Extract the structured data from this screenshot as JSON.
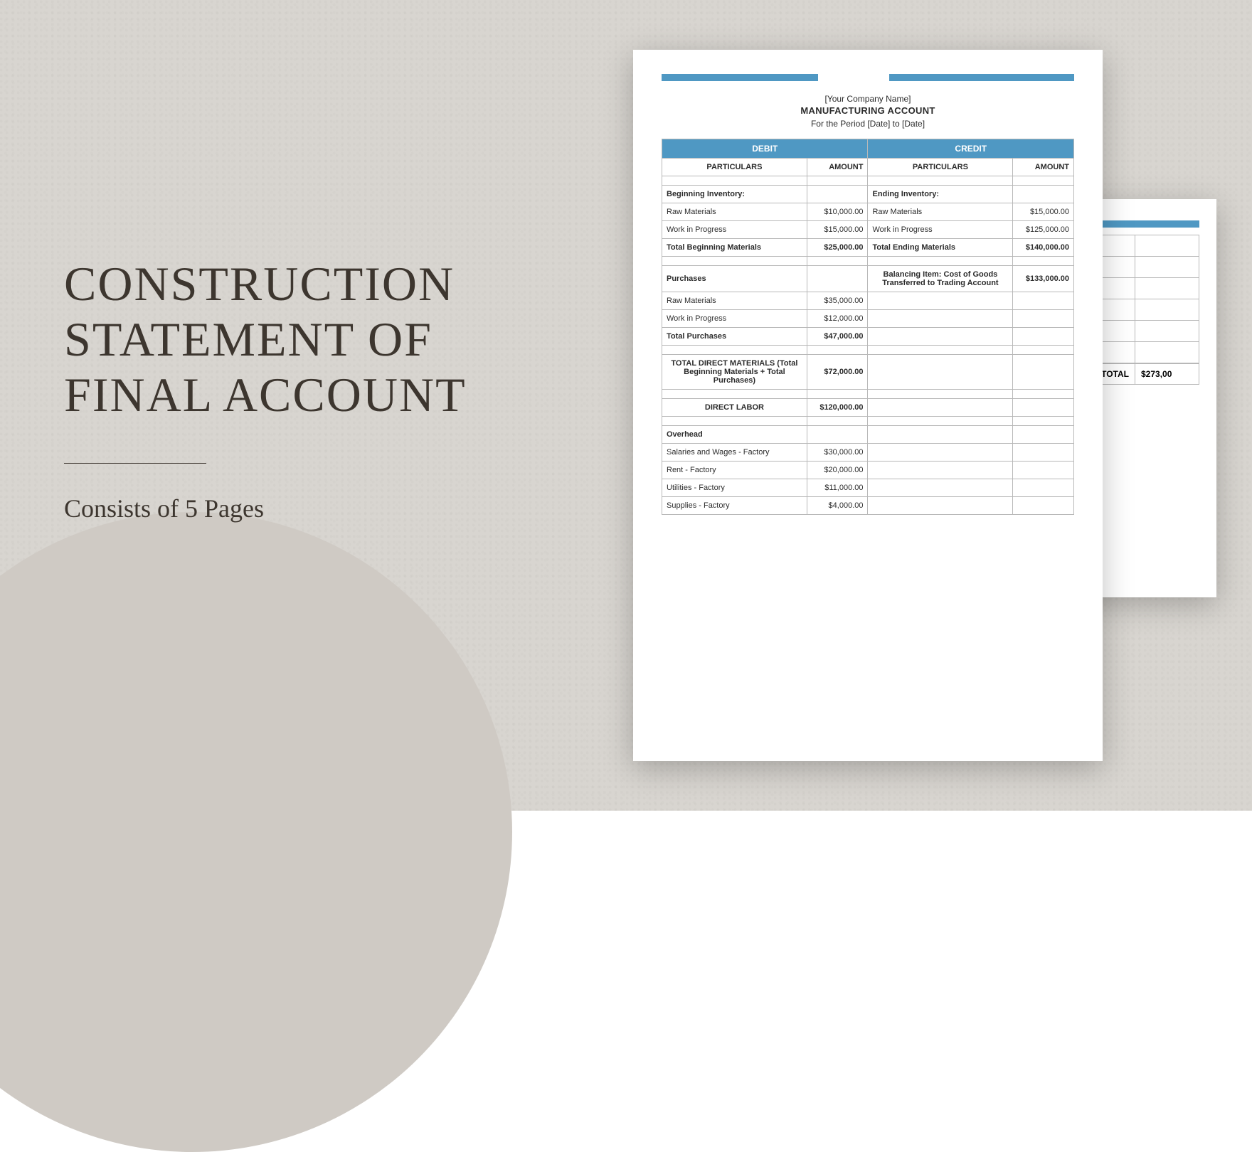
{
  "left": {
    "title_l1": "CONSTRUCTION",
    "title_l2": "STATEMENT OF",
    "title_l3": "FINAL ACCOUNT",
    "subtitle": "Consists of 5 Pages"
  },
  "accent_color": "#4f98c3",
  "doc": {
    "company": "[Your Company Name]",
    "title": "MANUFACTURING ACCOUNT",
    "period": "For the Period [Date] to [Date]",
    "hdr_debit": "DEBIT",
    "hdr_credit": "CREDIT",
    "hdr_part": "PARTICULARS",
    "hdr_amt": "AMOUNT",
    "debit": {
      "beg_inv_label": "Beginning Inventory:",
      "raw_label": "Raw Materials",
      "raw_amt": "$10,000.00",
      "wip_label": "Work in Progress",
      "wip_amt": "$15,000.00",
      "total_beg_label": "Total Beginning Materials",
      "total_beg_amt": "$25,000.00",
      "purchases_label": "Purchases",
      "p_raw_label": "Raw Materials",
      "p_raw_amt": "$35,000.00",
      "p_wip_label": "Work in Progress",
      "p_wip_amt": "$12,000.00",
      "total_purch_label": "Total Purchases",
      "total_purch_amt": "$47,000.00",
      "tdm_label": "TOTAL DIRECT MATERIALS (Total Beginning Materials + Total Purchases)",
      "tdm_amt": "$72,000.00",
      "dl_label": "DIRECT LABOR",
      "dl_amt": "$120,000.00",
      "ovh_label": "Overhead",
      "sal_label": "Salaries and Wages - Factory",
      "sal_amt": "$30,000.00",
      "rent_label": "Rent - Factory",
      "rent_amt": "$20,000.00",
      "util_label": "Utilities - Factory",
      "util_amt": "$11,000.00",
      "sup_label": "Supplies - Factory",
      "sup_amt": "$4,000.00"
    },
    "credit": {
      "end_inv_label": "Ending Inventory:",
      "raw_label": "Raw Materials",
      "raw_amt": "$15,000.00",
      "wip_label": "Work in Progress",
      "wip_amt": "$125,000.00",
      "total_end_label": "Total Ending Materials",
      "total_end_amt": "$140,000.00",
      "bal_label": "Balancing Item: Cost of Goods Transferred to Trading Account",
      "bal_amt": "$133,000.00"
    }
  },
  "back": {
    "total_label": "TOTAL",
    "total_amt": "$273,00"
  }
}
